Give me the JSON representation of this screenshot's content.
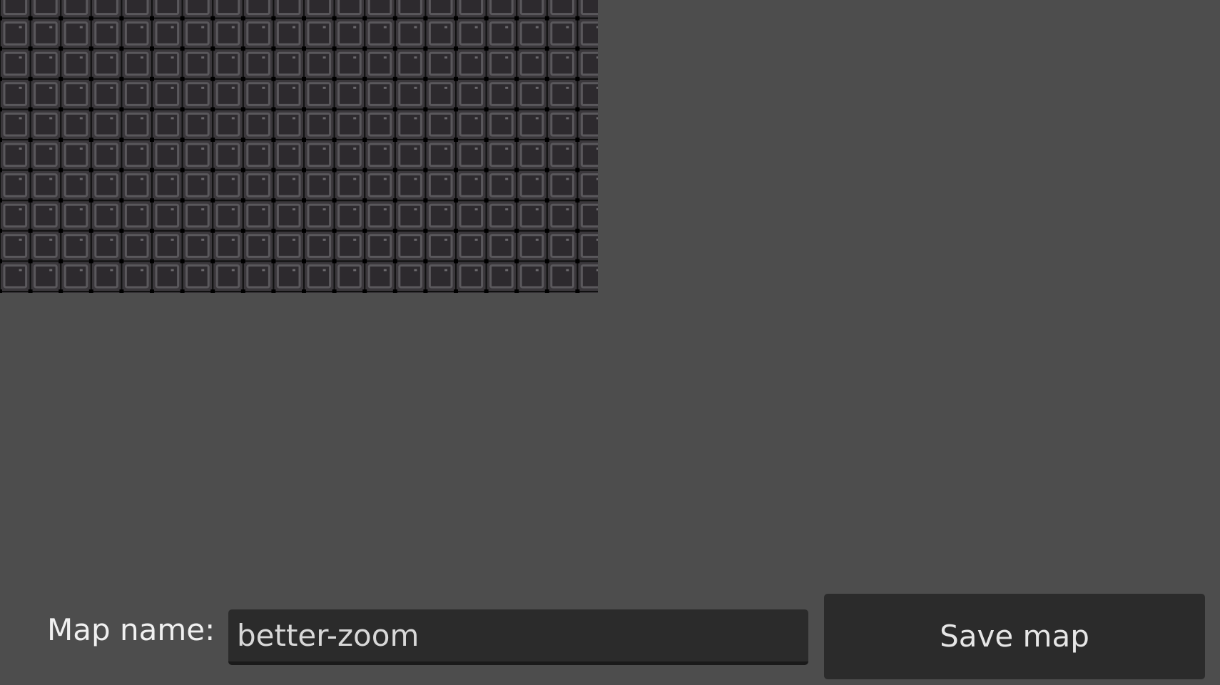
{
  "editor": {
    "map_name_label": "Map name:",
    "map_name_value": "better-zoom",
    "save_button_label": "Save map"
  },
  "tilemap": {
    "tile_type": "stone-floor",
    "columns": 20,
    "rows": 10,
    "partial_top_row": true
  },
  "colors": {
    "background": "#4d4d4d",
    "tile_fill": "#2d2a2e",
    "tile_border": "#5a585c",
    "grid_line": "#111111",
    "input_bg": "#2b2b2b",
    "button_bg": "#2b2b2b",
    "label_text": "#f0f0f0"
  }
}
